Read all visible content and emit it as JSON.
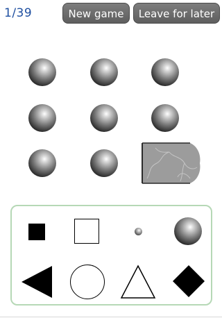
{
  "header": {
    "progress": "1/39",
    "new_game_label": "New game",
    "leave_label": "Leave for later"
  },
  "puzzle": {
    "grid_rows": 3,
    "grid_cols": 3,
    "cells": [
      "sphere",
      "sphere",
      "sphere",
      "sphere",
      "sphere",
      "sphere",
      "sphere",
      "sphere",
      "missing-piece"
    ]
  },
  "answers": {
    "options": [
      "small-filled-square",
      "outline-square",
      "small-sphere",
      "large-sphere",
      "filled-left-triangle",
      "outline-circle",
      "outline-triangle",
      "filled-diamond"
    ]
  },
  "colors": {
    "counter_text": "#1f4fa0",
    "button_bg": "#6b6b6b",
    "answer_panel_border": "#b6d8b6"
  }
}
